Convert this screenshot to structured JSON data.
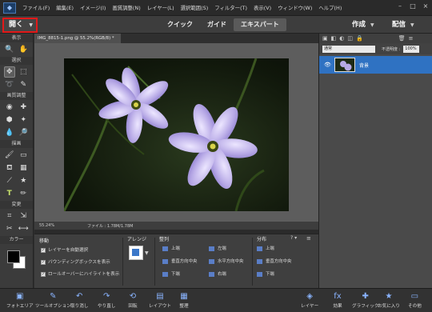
{
  "menubar": {
    "items": [
      "ファイル(F)",
      "編集(E)",
      "イメージ(I)",
      "画質調整(N)",
      "レイヤー(L)",
      "選択範囲(S)",
      "フィルター(T)",
      "表示(V)",
      "ウィンドウ(W)",
      "ヘルプ(H)"
    ],
    "window_controls": [
      "–",
      "□",
      "×"
    ]
  },
  "actionbar": {
    "open_label": "開く",
    "modes": [
      "クイック",
      "ガイド",
      "エキスパート"
    ],
    "active_mode": "エキスパート",
    "create_label": "作成",
    "share_label": "配信"
  },
  "toolbox": {
    "sections": [
      "表示",
      "選択",
      "画質調整",
      "描画",
      "変更",
      "カラー"
    ]
  },
  "document": {
    "tab_title": "IMG_8815-1.png @ 55.2%(RGB/8) *",
    "zoom": "55.24%",
    "file_info": "ファイル : 1.78M/1.78M"
  },
  "layers": {
    "blend_mode": "通常",
    "opacity_label": "不透明度 :",
    "opacity_value": "100%",
    "layer_name": "背景"
  },
  "tool_options": {
    "move_title": "移動",
    "checks": [
      "レイヤーを自動選択",
      "バウンディングボックスを表示",
      "ロールオーバーにハイライトを表示"
    ],
    "arrange_title": "アレンジ",
    "align_title": "整列",
    "align_items": [
      "上端",
      "垂直方向中央",
      "下端",
      "左端",
      "水平方向中央",
      "右端"
    ],
    "distribute_title": "分布",
    "distribute_items": [
      "上端",
      "垂直方向中央",
      "下端",
      "左端",
      "水平方向中央",
      "右端"
    ]
  },
  "bottombar": {
    "left": [
      "フォトエリア",
      "ツールオプション",
      "取り消し",
      "やり直し",
      "回転",
      "レイアウト",
      "整理"
    ],
    "right": [
      "レイヤー",
      "効果",
      "グラフィック",
      "お気に入り",
      "その他"
    ]
  },
  "colors": {
    "accent": "#2f72c2",
    "open_highlight": "#e21919",
    "petal": "#b7a9e6"
  }
}
